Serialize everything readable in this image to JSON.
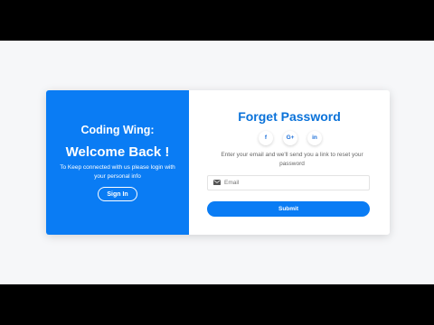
{
  "left_panel": {
    "brand": "Coding Wing:",
    "heading": "Welcome Back !",
    "info": "To Keep connected with us please login with your personal info",
    "signin_label": "Sign In"
  },
  "right_panel": {
    "title": "Forget Password",
    "social": [
      {
        "icon": "facebook-icon",
        "glyph": "f"
      },
      {
        "icon": "google-plus-icon",
        "glyph": "G+"
      },
      {
        "icon": "linkedin-icon",
        "glyph": "in"
      }
    ],
    "description": "Enter your email and we'll send you a link to reset your password",
    "email_placeholder": "Email",
    "submit_label": "Submit"
  },
  "colors": {
    "accent": "#0a7cf4",
    "title": "#0a72d9",
    "page_background": "#f6f7f9",
    "letterbox": "#000000"
  }
}
